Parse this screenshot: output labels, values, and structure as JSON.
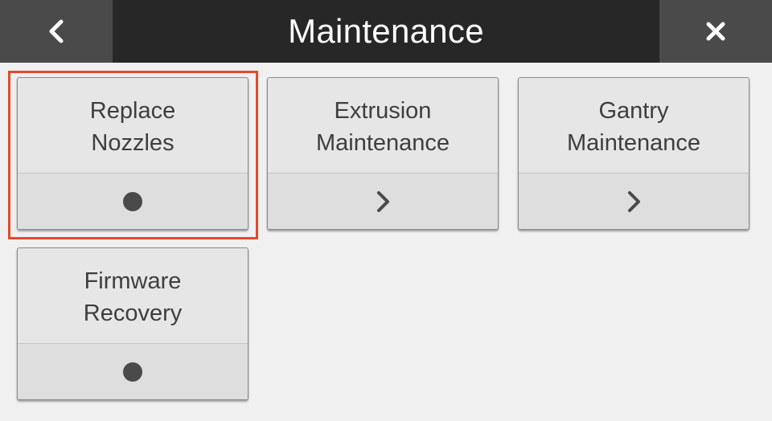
{
  "header": {
    "title": "Maintenance",
    "back_icon": "chevron-left-icon",
    "close_icon": "close-icon"
  },
  "colors": {
    "header_bg": "#272727",
    "header_button_bg": "#4a4a4a",
    "selection_border": "#e24a2c",
    "tile_bg": "#e6e6e6"
  },
  "tiles": [
    {
      "label": "Replace\nNozzles",
      "indicator": "dot-icon",
      "selected": true
    },
    {
      "label": "Extrusion\nMaintenance",
      "indicator": "chevron-right-icon",
      "selected": false
    },
    {
      "label": "Gantry\nMaintenance",
      "indicator": "chevron-right-icon",
      "selected": false
    },
    {
      "label": "Firmware\nRecovery",
      "indicator": "dot-icon",
      "selected": false
    }
  ]
}
